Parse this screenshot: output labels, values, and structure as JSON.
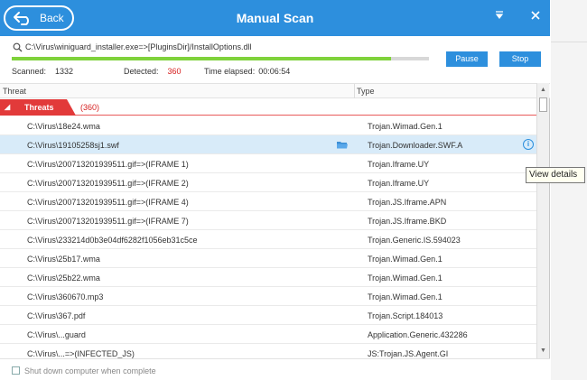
{
  "window": {
    "title": "Manual Scan",
    "back_label": "Back"
  },
  "scan": {
    "current_path": "C:\\Virus\\winiguard_installer.exe=>[PluginsDir]/InstallOptions.dll",
    "progress": 0.91,
    "scanned_label": "Scanned:",
    "scanned_value": "1332",
    "detected_label": "Detected:",
    "detected_value": "360",
    "elapsed_label": "Time elapsed:",
    "elapsed_value": "00:06:54",
    "pause_label": "Pause",
    "stop_label": "Stop"
  },
  "list": {
    "columns": [
      "Threat",
      "Type"
    ],
    "group": {
      "label": "Threats",
      "count": "(360)"
    },
    "rows": [
      {
        "path": "C:\\Virus\\18e24.wma",
        "type": "Trojan.Wimad.Gen.1"
      },
      {
        "path": "C:\\Virus\\19105258sj1.swf",
        "type": "Trojan.Downloader.SWF.A"
      },
      {
        "path": "C:\\Virus\\200713201939511.gif=>(IFRAME   1)",
        "type": "Trojan.Iframe.UY"
      },
      {
        "path": "C:\\Virus\\200713201939511.gif=>(IFRAME   2)",
        "type": "Trojan.Iframe.UY"
      },
      {
        "path": "C:\\Virus\\200713201939511.gif=>(IFRAME   4)",
        "type": "Trojan.JS.Iframe.APN"
      },
      {
        "path": "C:\\Virus\\200713201939511.gif=>(IFRAME   7)",
        "type": "Trojan.JS.Iframe.BKD"
      },
      {
        "path": "C:\\Virus\\233214d0b3e04df6282f1056eb31c5ce",
        "type": "Trojan.Generic.IS.594023"
      },
      {
        "path": "C:\\Virus\\25b17.wma",
        "type": "Trojan.Wimad.Gen.1"
      },
      {
        "path": "C:\\Virus\\25b22.wma",
        "type": "Trojan.Wimad.Gen.1"
      },
      {
        "path": "C:\\Virus\\360670.mp3",
        "type": "Trojan.Wimad.Gen.1"
      },
      {
        "path": "C:\\Virus\\367.pdf",
        "type": "Trojan.Script.184013"
      },
      {
        "path": "C:\\Virus\\...guard",
        "type": "Application.Generic.432286"
      },
      {
        "path": "C:\\Virus\\...=>(INFECTED_JS)",
        "type": "JS:Trojan.JS.Agent.GI"
      }
    ]
  },
  "footer": {
    "shutdown_label": "Shut down computer when complete"
  },
  "tooltip": {
    "text": "View details"
  },
  "colors": {
    "accent": "#2d8fdd",
    "danger": "#e23a3a",
    "progress": "#7fd23b",
    "selected_row": "#d8ebf9"
  },
  "icons": [
    "back-arrow-icon",
    "search-icon",
    "folder-icon",
    "info-icon",
    "filter-icon",
    "close-icon",
    "collapse-arrow-icon"
  ]
}
